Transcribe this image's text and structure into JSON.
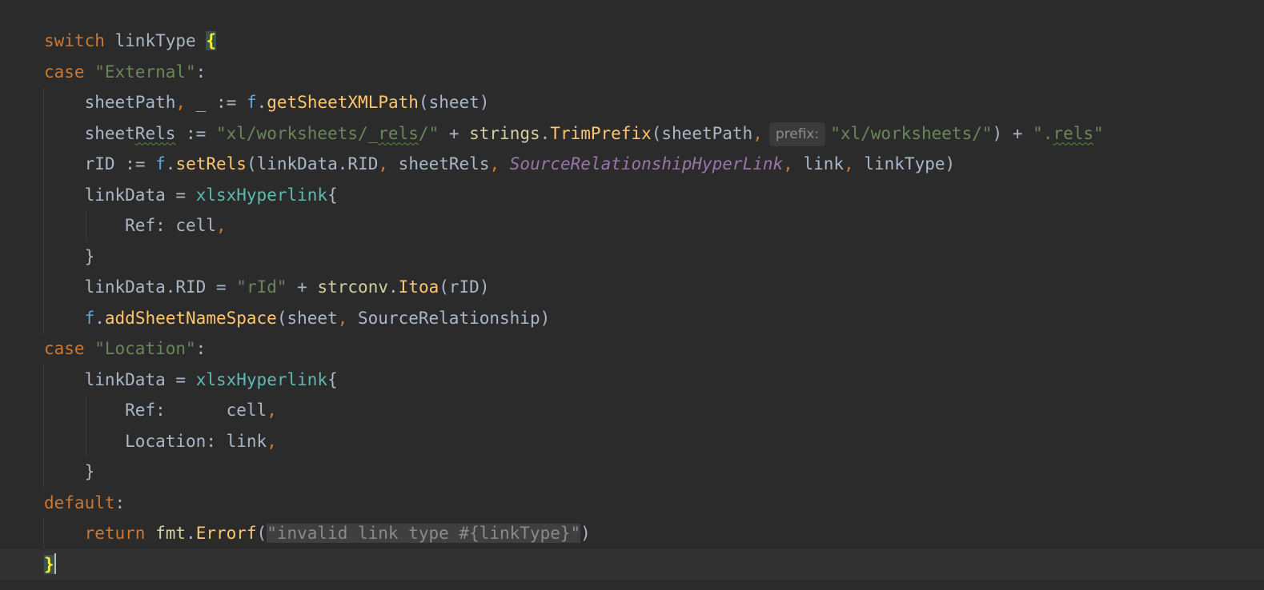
{
  "code": {
    "keywords": {
      "switch": "switch",
      "case": "case",
      "default": "default",
      "return": "return"
    },
    "idents": {
      "linkType": "linkType",
      "sheetPath": "sheetPath",
      "underscore": "_",
      "f": "f",
      "getSheetXMLPath": "getSheetXMLPath",
      "sheet": "sheet",
      "sheetRels": "sheetRels",
      "strings": "strings",
      "TrimPrefix": "TrimPrefix",
      "rID": "rID",
      "setRels": "setRels",
      "linkData": "linkData",
      "RID": "RID",
      "SourceRelationshipHyperLink": "SourceRelationshipHyperLink",
      "link": "link",
      "xlsxHyperlink": "xlsxHyperlink",
      "Ref": "Ref",
      "cell": "cell",
      "strconv": "strconv",
      "Itoa": "Itoa",
      "addSheetNameSpace": "addSheetNameSpace",
      "SourceRelationship": "SourceRelationship",
      "Location": "Location",
      "fmt": "fmt",
      "Errorf": "Errorf"
    },
    "strings": {
      "external": "\"External\"",
      "rels_prefix_a": "\"xl/worksheets/_",
      "rels_word": "rels",
      "rels_prefix_b": "/\"",
      "worksheets": "\"xl/worksheets/\"",
      "rels_ext_a": "\".",
      "rels_ext_b": "\"",
      "rId": "\"rId\"",
      "location": "\"Location\"",
      "invalid": "\"invalid link type #{linkType}\""
    },
    "hints": {
      "prefix": "prefix:"
    },
    "spacing": {
      "ref_pad": "      "
    }
  }
}
